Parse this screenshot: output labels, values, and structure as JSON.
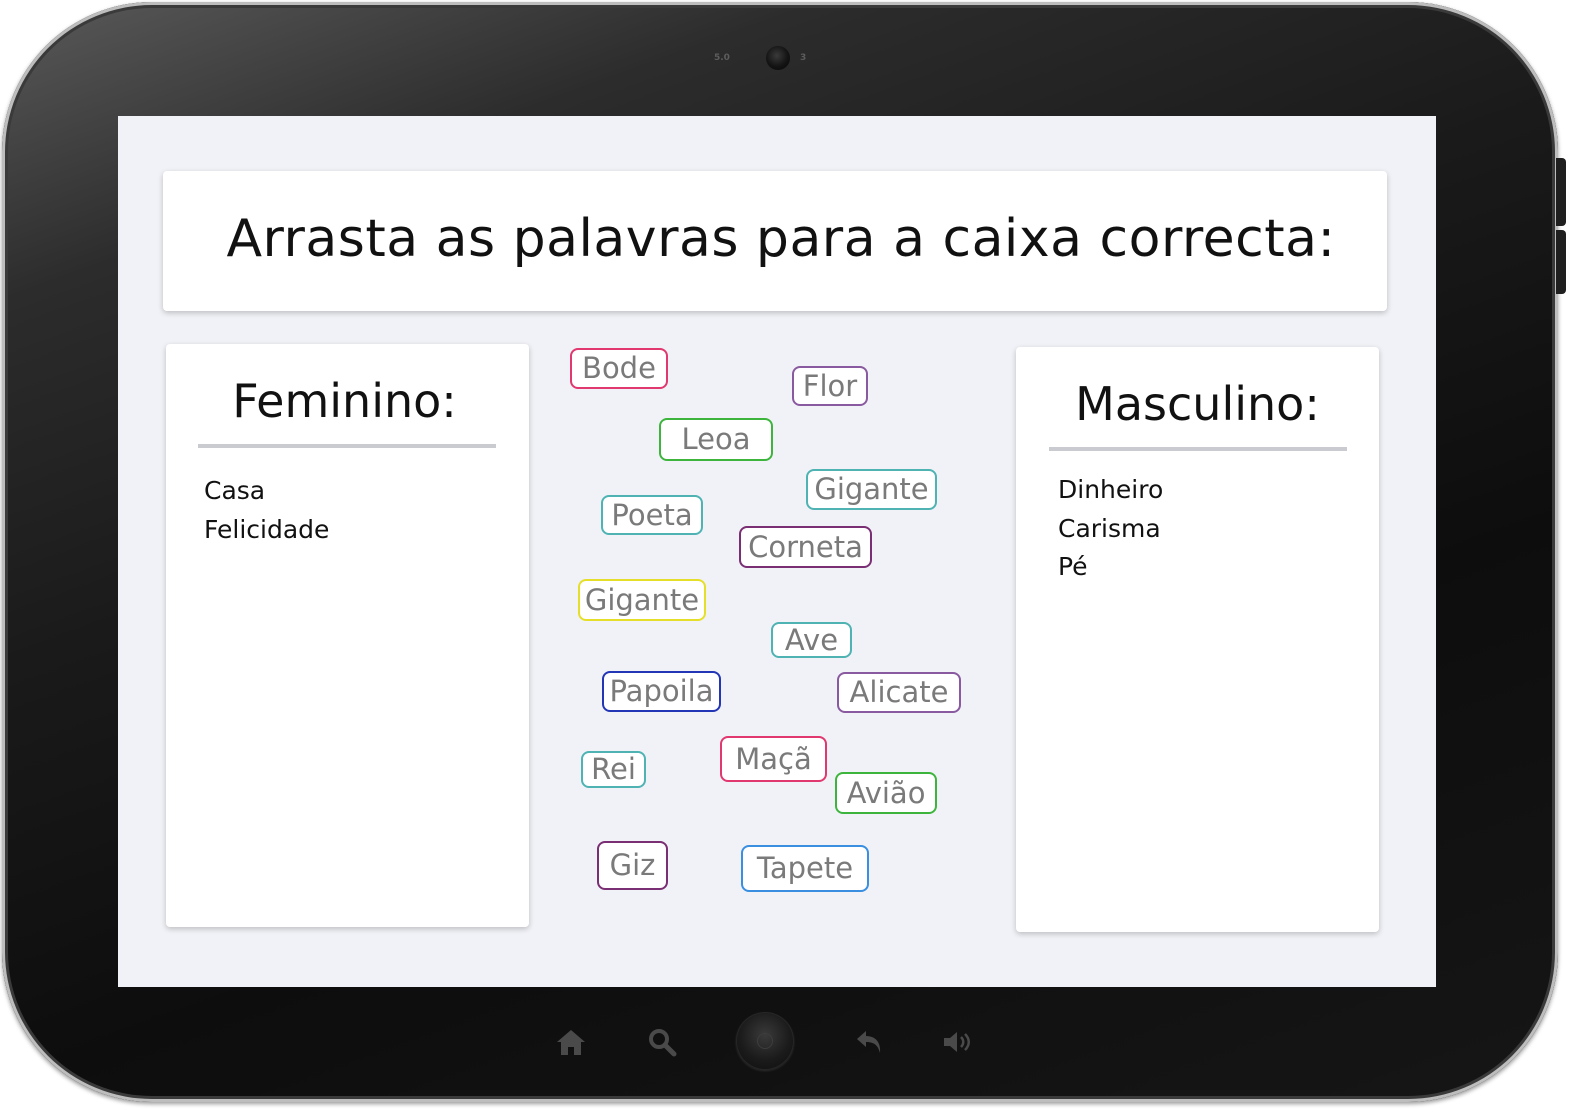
{
  "device": {
    "camera_left_label": "5.0",
    "camera_right_label": "3"
  },
  "header": {
    "title": "Arrasta as palavras para a caixa correcta:"
  },
  "boxes": {
    "feminine": {
      "title": "Feminino:",
      "items": [
        "Casa",
        "Felicidade"
      ]
    },
    "masculine": {
      "title": "Masculino:",
      "items": [
        "Dinheiro",
        "Carisma",
        "Pé"
      ]
    }
  },
  "words": [
    {
      "label": "Bode",
      "color": "#e0386f"
    },
    {
      "label": "Flor",
      "color": "#8a5aa0"
    },
    {
      "label": "Leoa",
      "color": "#3db53d"
    },
    {
      "label": "Gigante",
      "color": "#4fb3b3"
    },
    {
      "label": "Poeta",
      "color": "#4fb3b3"
    },
    {
      "label": "Corneta",
      "color": "#7a2e74"
    },
    {
      "label": "Gigante",
      "color": "#e6df2a"
    },
    {
      "label": "Ave",
      "color": "#4fb3b3"
    },
    {
      "label": "Papoila",
      "color": "#2336b5"
    },
    {
      "label": "Alicate",
      "color": "#8a5aa0"
    },
    {
      "label": "Rei",
      "color": "#4fb3b3"
    },
    {
      "label": "Maçã",
      "color": "#e0386f"
    },
    {
      "label": "Avião",
      "color": "#3db53d"
    },
    {
      "label": "Giz",
      "color": "#7a2e74"
    },
    {
      "label": "Tapete",
      "color": "#3a8fe0"
    }
  ],
  "nav": {
    "icons": [
      "home-icon",
      "search-icon",
      "home-button",
      "back-icon",
      "volume-icon"
    ]
  }
}
